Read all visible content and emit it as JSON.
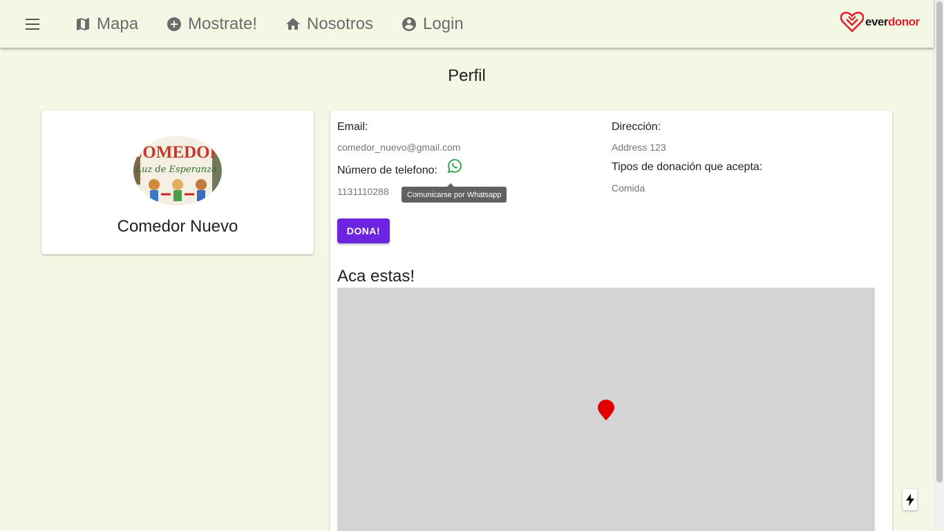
{
  "nav": {
    "items": [
      {
        "label": "Mapa",
        "icon": "map-icon"
      },
      {
        "label": "Mostrate!",
        "icon": "add-circle-icon"
      },
      {
        "label": "Nosotros",
        "icon": "home-icon"
      },
      {
        "label": "Login",
        "icon": "account-circle-icon"
      }
    ],
    "logo": {
      "text_dark": "ever",
      "text_red": "donor",
      "icon": "heart-logo-icon"
    }
  },
  "page": {
    "title": "Perfil"
  },
  "profile": {
    "name": "Comedor Nuevo",
    "avatar_icon": "comedor-photo-image"
  },
  "details": {
    "email_label": "Email:",
    "email_value": "comedor_nuevo@gmail.com",
    "phone_label": "Número de telefono:",
    "phone_value": "1131110288",
    "whatsapp_tooltip": "Comunicarse por Whatsapp",
    "address_label": "Dirección:",
    "address_value": "Address 123",
    "donation_types_label": "Tipos de donación que acepta:",
    "donation_types_value": "Comida",
    "donate_button": "DONA!"
  },
  "map": {
    "title": "Aca estas!",
    "marker_icon": "map-pin-icon"
  },
  "colors": {
    "background": "#f3f8e5",
    "primary": "#6d24e0",
    "whatsapp": "#25a244",
    "marker": "#e00000",
    "brand_red": "#e0202a"
  }
}
